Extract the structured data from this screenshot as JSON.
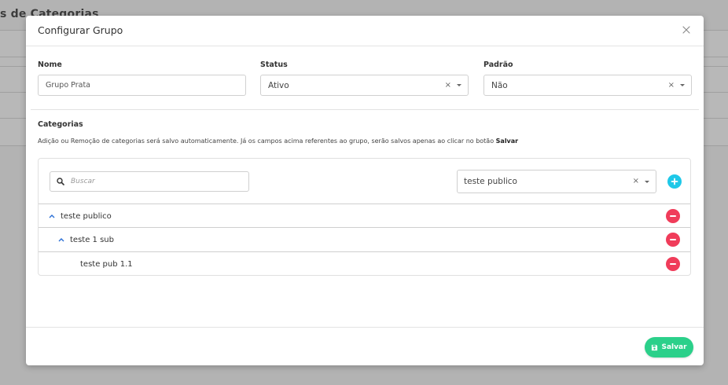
{
  "background": {
    "title": "s de Categorias"
  },
  "modal": {
    "title": "Configurar Grupo",
    "fields": {
      "nome": {
        "label": "Nome",
        "value": "Grupo Prata"
      },
      "status": {
        "label": "Status",
        "value": "Ativo"
      },
      "padrao": {
        "label": "Padrão",
        "value": "Não"
      }
    },
    "categories": {
      "title": "Categorias",
      "helper_text": "Adição ou Remoção de categorias será salvo automaticamente. Já os campos acima referentes ao grupo, serão salvos apenas ao clicar no botão",
      "helper_bold": "Salvar",
      "search_placeholder": "Buscar",
      "selected_category": "teste publico",
      "tree": [
        {
          "label": "teste publico",
          "level": 0,
          "expanded": true
        },
        {
          "label": "teste 1 sub",
          "level": 1,
          "expanded": true
        },
        {
          "label": "teste pub 1.1",
          "level": 2,
          "expanded": false
        }
      ]
    },
    "footer": {
      "save_label": "Salvar"
    }
  },
  "colors": {
    "accent_add": "#1ec8e8",
    "remove": "#f03c5a",
    "save": "#2bd08a",
    "chevron": "#2a6fd6"
  },
  "icons": {
    "close": "close-icon",
    "clear": "clear-icon",
    "caret": "caret-down-icon",
    "search": "search-icon",
    "add": "plus-icon",
    "remove": "minus-icon",
    "chevron": "chevron-up-icon",
    "save": "floppy-disk-icon"
  }
}
